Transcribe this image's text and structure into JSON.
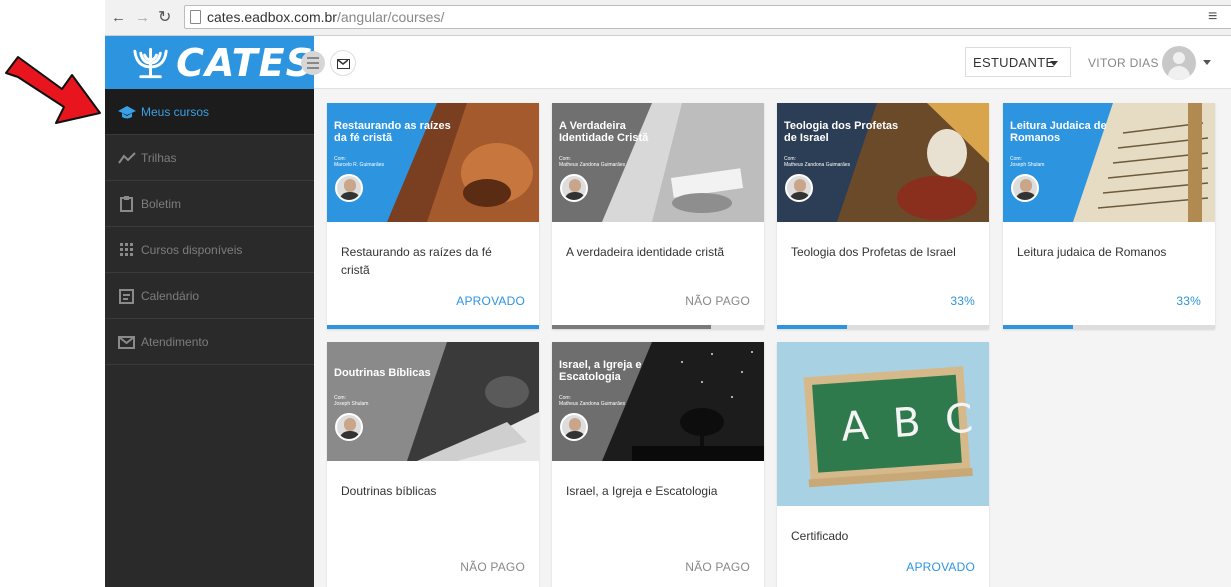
{
  "browser": {
    "url_host": "cates.eadbox.com.br",
    "url_path": "/angular/courses/"
  },
  "header": {
    "logo_text": "CATES",
    "role_label": "ESTUDANTE",
    "user_name": "VITOR DIAS"
  },
  "sidebar": {
    "items": [
      {
        "label": "Meus cursos",
        "icon": "graduation-cap-icon",
        "active": true
      },
      {
        "label": "Trilhas",
        "icon": "trend-line-icon",
        "active": false
      },
      {
        "label": "Boletim",
        "icon": "clipboard-icon",
        "active": false
      },
      {
        "label": "Cursos disponíveis",
        "icon": "grid-icon",
        "active": false
      },
      {
        "label": "Calendário",
        "icon": "calendar-icon",
        "active": false
      },
      {
        "label": "Atendimento",
        "icon": "envelope-icon",
        "active": false
      }
    ]
  },
  "courses": [
    {
      "banner_title": "Restaurando as raízes da fé cristã",
      "instructor_label": "Com:",
      "instructor": "Marcelo R. Guimarães",
      "name": "Restaurando as raízes da fé cristã",
      "status": "APROVADO",
      "progress": 1.0,
      "banner_color": "#2d95e0",
      "bar_color": "#2d95e0"
    },
    {
      "banner_title": "A Verdadeira Identidade Cristã",
      "instructor_label": "Com:",
      "instructor": "Matheus Zandona Guimarães",
      "name": "A verdadeira identidade cristã",
      "status": "NÃO PAGO",
      "progress": 0.75,
      "banner_color": "#707070",
      "bar_color": "#7a7a7a"
    },
    {
      "banner_title": "Teologia dos Profetas de Israel",
      "instructor_label": "Com:",
      "instructor": "Matheus Zandona Guimarães",
      "name": "Teologia dos Profetas de Israel",
      "status": "33%",
      "progress": 0.33,
      "banner_color": "#2c3e55",
      "bar_color": "#2d95e0"
    },
    {
      "banner_title": "Leitura Judaica de Romanos",
      "instructor_label": "Com:",
      "instructor": "Joseph Shulam",
      "name": "Leitura judaica de Romanos",
      "status": "33%",
      "progress": 0.33,
      "banner_color": "#2d95e0",
      "bar_color": "#2d95e0"
    },
    {
      "banner_title": "Doutrinas Bíblicas",
      "instructor_label": "Com:",
      "instructor": "Joseph Shulam",
      "name": "Doutrinas bíblicas",
      "status": "NÃO PAGO",
      "progress": 0,
      "banner_color": "#8a8a8a",
      "bar_color": "#7a7a7a"
    },
    {
      "banner_title": "Israel, a Igreja e Escatologia",
      "instructor_label": "Com:",
      "instructor": "Matheus Zandona Guimarães",
      "name": "Israel, a Igreja e Escatologia",
      "status": "NÃO PAGO",
      "progress": 0,
      "banner_color": "#6e6e6e",
      "bar_color": "#7a7a7a"
    },
    {
      "banner_title": "",
      "instructor_label": "",
      "instructor": "",
      "name": "Certificado",
      "status": "APROVADO",
      "progress": 0,
      "banner_color": "#a8d2e4",
      "bar_color": "#2d95e0"
    }
  ],
  "chalkboard": {
    "letters": "A B C"
  }
}
